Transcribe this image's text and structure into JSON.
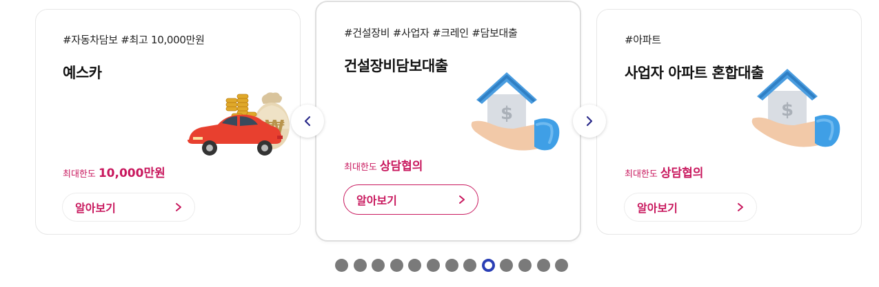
{
  "cards": [
    {
      "tags": "#자동차담보 #최고 10,000만원",
      "title": "예스카",
      "limit_label": "최대한도",
      "limit_value": "10,000만원",
      "button_label": "알아보기",
      "icon": "car-with-money-icon"
    },
    {
      "tags": "#건설장비 #사업자 #크레인 #담보대출",
      "title": "건설장비담보대출",
      "limit_label": "최대한도",
      "limit_value": "상담협의",
      "button_label": "알아보기",
      "icon": "house-in-hand-icon"
    },
    {
      "tags": "#아파트",
      "title": "사업자 아파트 혼합대출",
      "limit_label": "최대한도",
      "limit_value": "상담협의",
      "button_label": "알아보기",
      "icon": "house-in-hand-icon"
    }
  ],
  "carousel": {
    "prev_icon": "chevron-left-icon",
    "next_icon": "chevron-right-icon",
    "total_pages": 13,
    "active_page": 9
  },
  "colors": {
    "accent": "#c8175d",
    "arrow": "#2a2a8a",
    "dot": "#7a7a7a",
    "dot_active": "#2a3fb5"
  }
}
